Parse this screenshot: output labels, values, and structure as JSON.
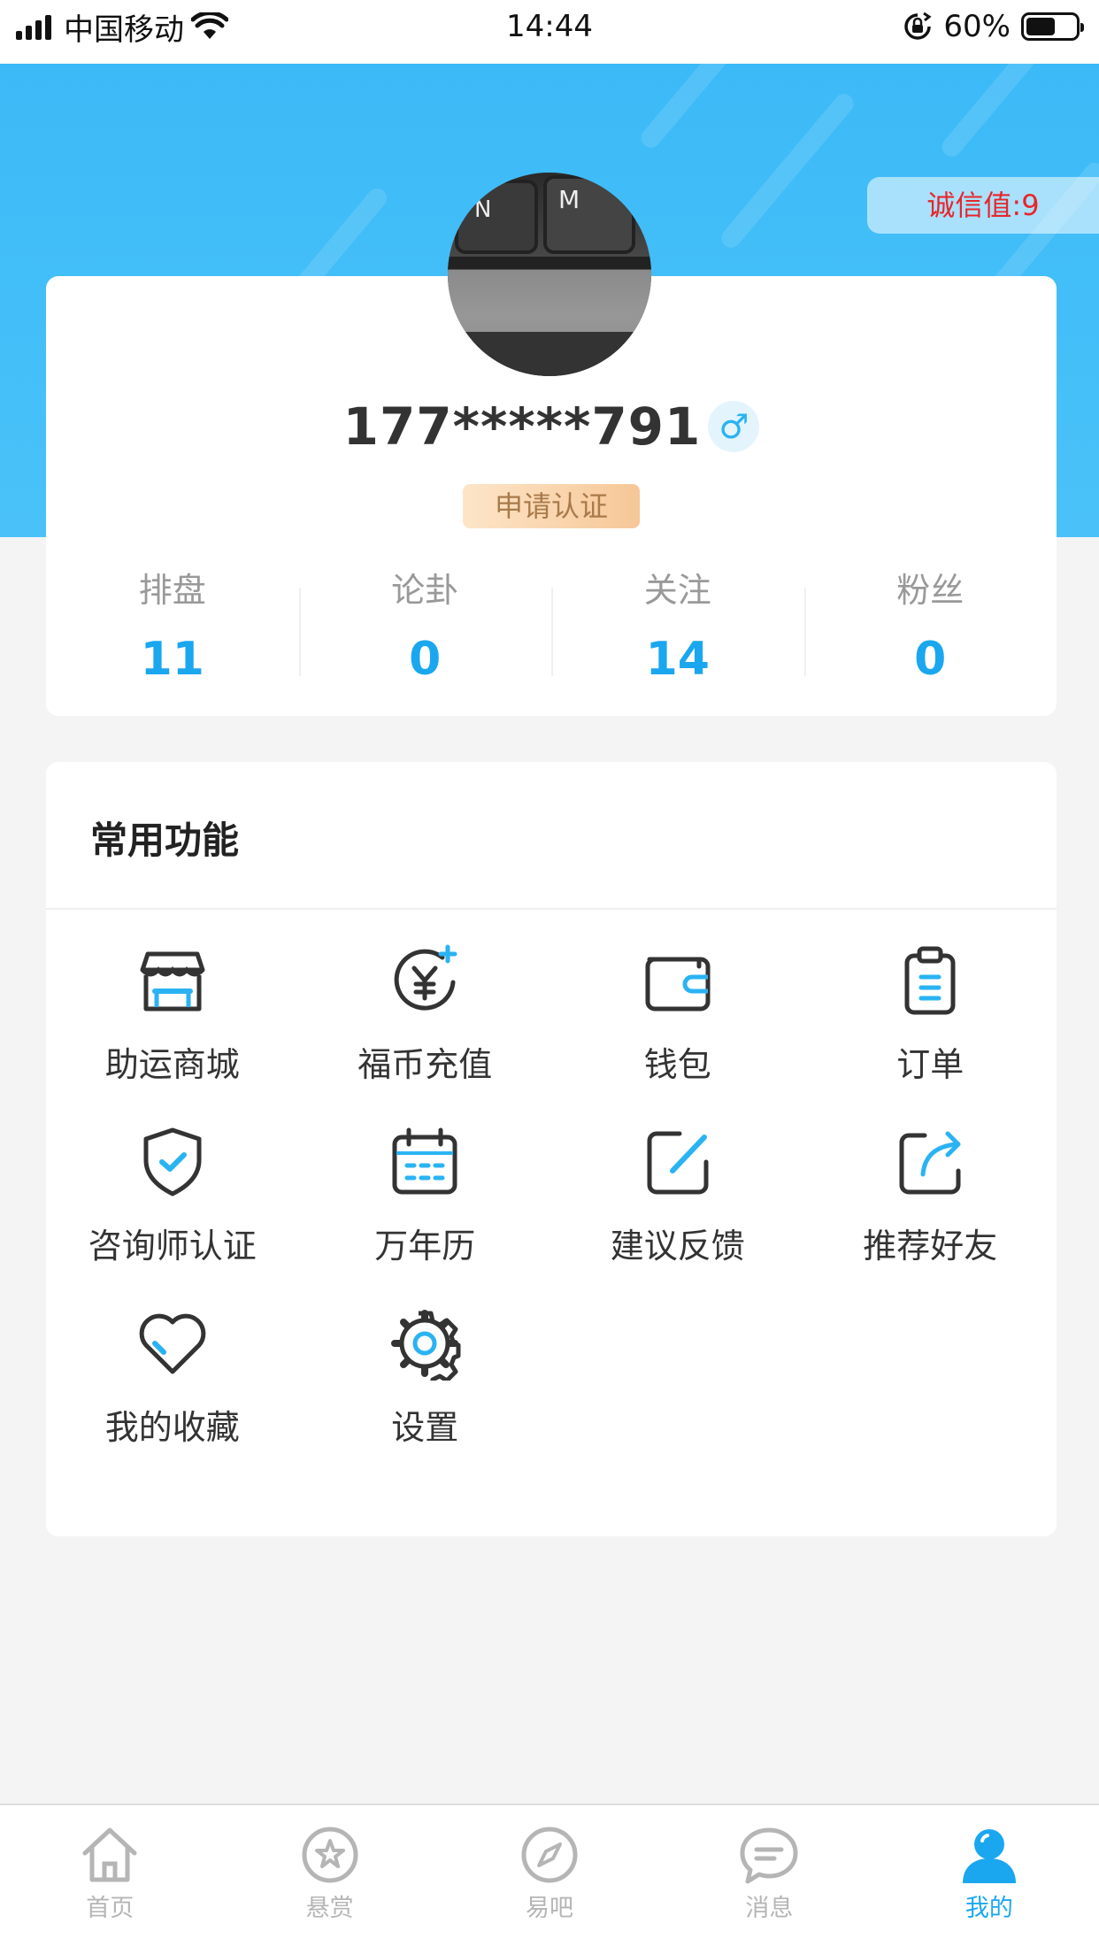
{
  "status_bar": {
    "carrier": "中国移动",
    "time": "14:44",
    "battery": "60%",
    "battery_level": 0.6
  },
  "header": {
    "credit": "诚信值:9"
  },
  "profile": {
    "username": "177*****791",
    "gender_symbol": "♂",
    "verify_label": "申请认证",
    "stats": [
      {
        "label": "排盘",
        "value": "11"
      },
      {
        "label": "论卦",
        "value": "0"
      },
      {
        "label": "关注",
        "value": "14"
      },
      {
        "label": "粉丝",
        "value": "0"
      }
    ]
  },
  "functions": {
    "title": "常用功能",
    "items": [
      {
        "label": "助运商城",
        "icon": "store-icon"
      },
      {
        "label": "福币充值",
        "icon": "coin-recharge-icon"
      },
      {
        "label": "钱包",
        "icon": "wallet-icon"
      },
      {
        "label": "订单",
        "icon": "clipboard-icon"
      },
      {
        "label": "咨询师认证",
        "icon": "shield-check-icon"
      },
      {
        "label": "万年历",
        "icon": "calendar-icon"
      },
      {
        "label": "建议反馈",
        "icon": "edit-icon"
      },
      {
        "label": "推荐好友",
        "icon": "share-icon"
      },
      {
        "label": "我的收藏",
        "icon": "heart-icon"
      },
      {
        "label": "设置",
        "icon": "gear-icon"
      }
    ]
  },
  "tabs": [
    {
      "label": "首页",
      "icon": "home-icon"
    },
    {
      "label": "悬赏",
      "icon": "star-icon"
    },
    {
      "label": "易吧",
      "icon": "compass-icon"
    },
    {
      "label": "消息",
      "icon": "message-icon"
    },
    {
      "label": "我的",
      "icon": "user-icon",
      "active": true
    }
  ],
  "colors": {
    "primary": "#1aa7ef",
    "header_blue": "#3cbaf7",
    "credit_red": "#e8262b",
    "verify_gold": "#a97a4a"
  }
}
